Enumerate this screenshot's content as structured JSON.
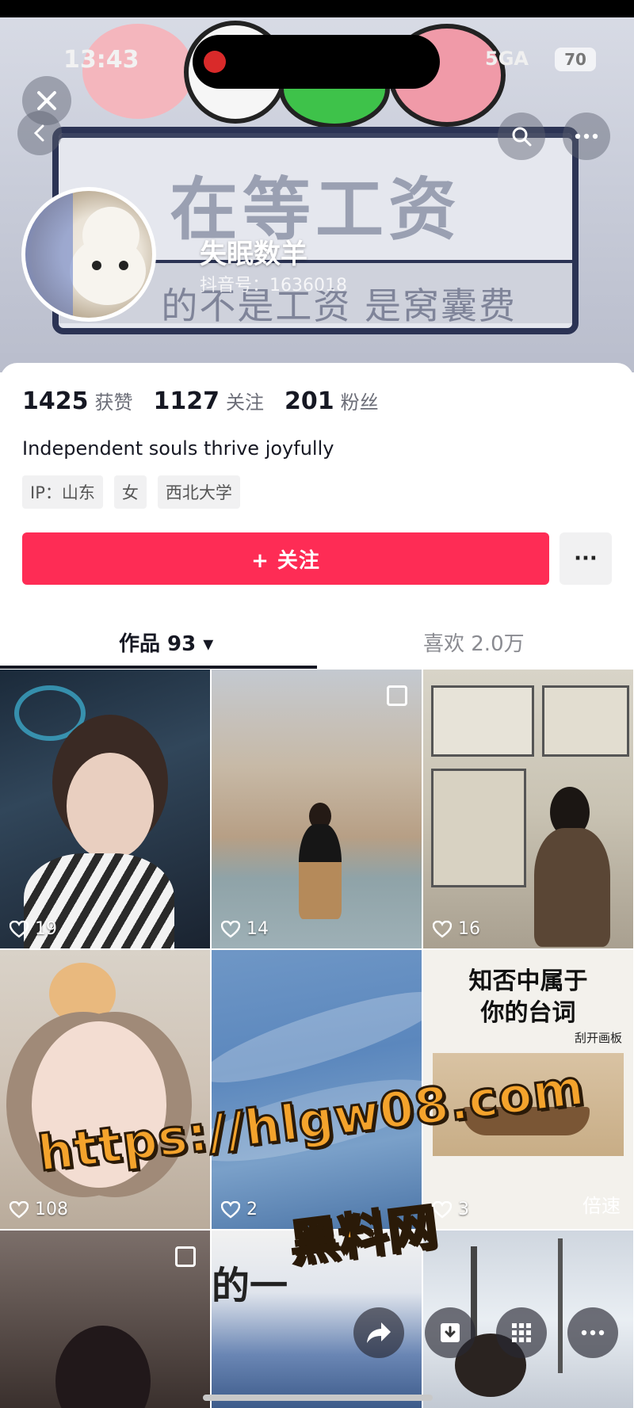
{
  "status_bar": {
    "time": "13:43",
    "network": "5GA",
    "battery": "70"
  },
  "banner": {
    "sign_title": "在等工资",
    "sign_subtitle": "的不是工资 是窝囊费",
    "back_icon": "chevron-left-icon",
    "close_icon": "close-icon",
    "search_icon": "search-icon",
    "more_icon": "more-horizontal-icon"
  },
  "profile": {
    "nickname": "失眠数羊",
    "douyin_id": "抖音号：1636018"
  },
  "stats": [
    {
      "value": "1425",
      "label": "获赞"
    },
    {
      "value": "1127",
      "label": "关注"
    },
    {
      "value": "201",
      "label": "粉丝"
    }
  ],
  "bio": "Independent souls thrive joyfully",
  "tags": [
    "IP：山东",
    "女",
    "西北大学"
  ],
  "actions": {
    "follow_label": "+ 关注",
    "more_label": "···"
  },
  "tabs": {
    "works": "作品 93 ▾",
    "likes": "喜欢 2.0万"
  },
  "videos": [
    {
      "likes": "19"
    },
    {
      "likes": "14"
    },
    {
      "likes": "16"
    },
    {
      "likes": "108"
    },
    {
      "likes": "2"
    },
    {
      "likes": "3",
      "title_line1": "知否中属于",
      "title_line2": "你的台词",
      "caption": "刮开画板",
      "speed": "倍速"
    },
    {
      "likes": ""
    },
    {
      "likes": "",
      "overlay_text": "的一"
    },
    {
      "likes": ""
    }
  ],
  "watermark": {
    "url": "https://hlgw08.com",
    "name": "黑料网"
  },
  "colors": {
    "accent": "#fe2c55",
    "watermark": "#f4a32c"
  }
}
